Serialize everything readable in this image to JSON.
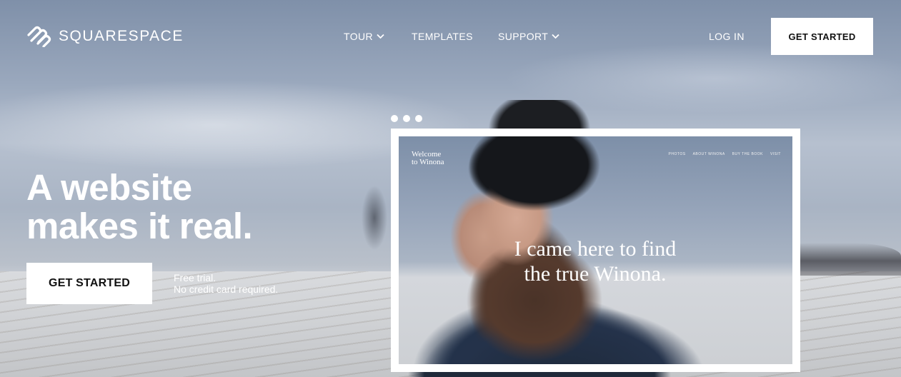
{
  "brand": {
    "name": "SQUARESPACE",
    "logo_icon": "squarespace-logo-icon"
  },
  "nav": {
    "items": [
      {
        "label": "TOUR",
        "has_dropdown": true
      },
      {
        "label": "TEMPLATES",
        "has_dropdown": false
      },
      {
        "label": "SUPPORT",
        "has_dropdown": true
      }
    ],
    "login_label": "LOG IN",
    "cta_label": "GET STARTED"
  },
  "hero": {
    "title_line1": "A website",
    "title_line2": "makes it real.",
    "cta_label": "GET STARTED",
    "trial_line1": "Free trial.",
    "trial_line2": "No credit card required."
  },
  "preview": {
    "brand_line1": "Welcome",
    "brand_line2": "to Winona",
    "nav_items": [
      "PHOTOS",
      "ABOUT WINONA",
      "BUY THE BOOK",
      "VISIT"
    ],
    "headline_line1": "I came here to find",
    "headline_line2": "the true Winona."
  },
  "colors": {
    "text_light": "#ffffff",
    "button_bg": "#ffffff",
    "button_text": "#111111"
  }
}
